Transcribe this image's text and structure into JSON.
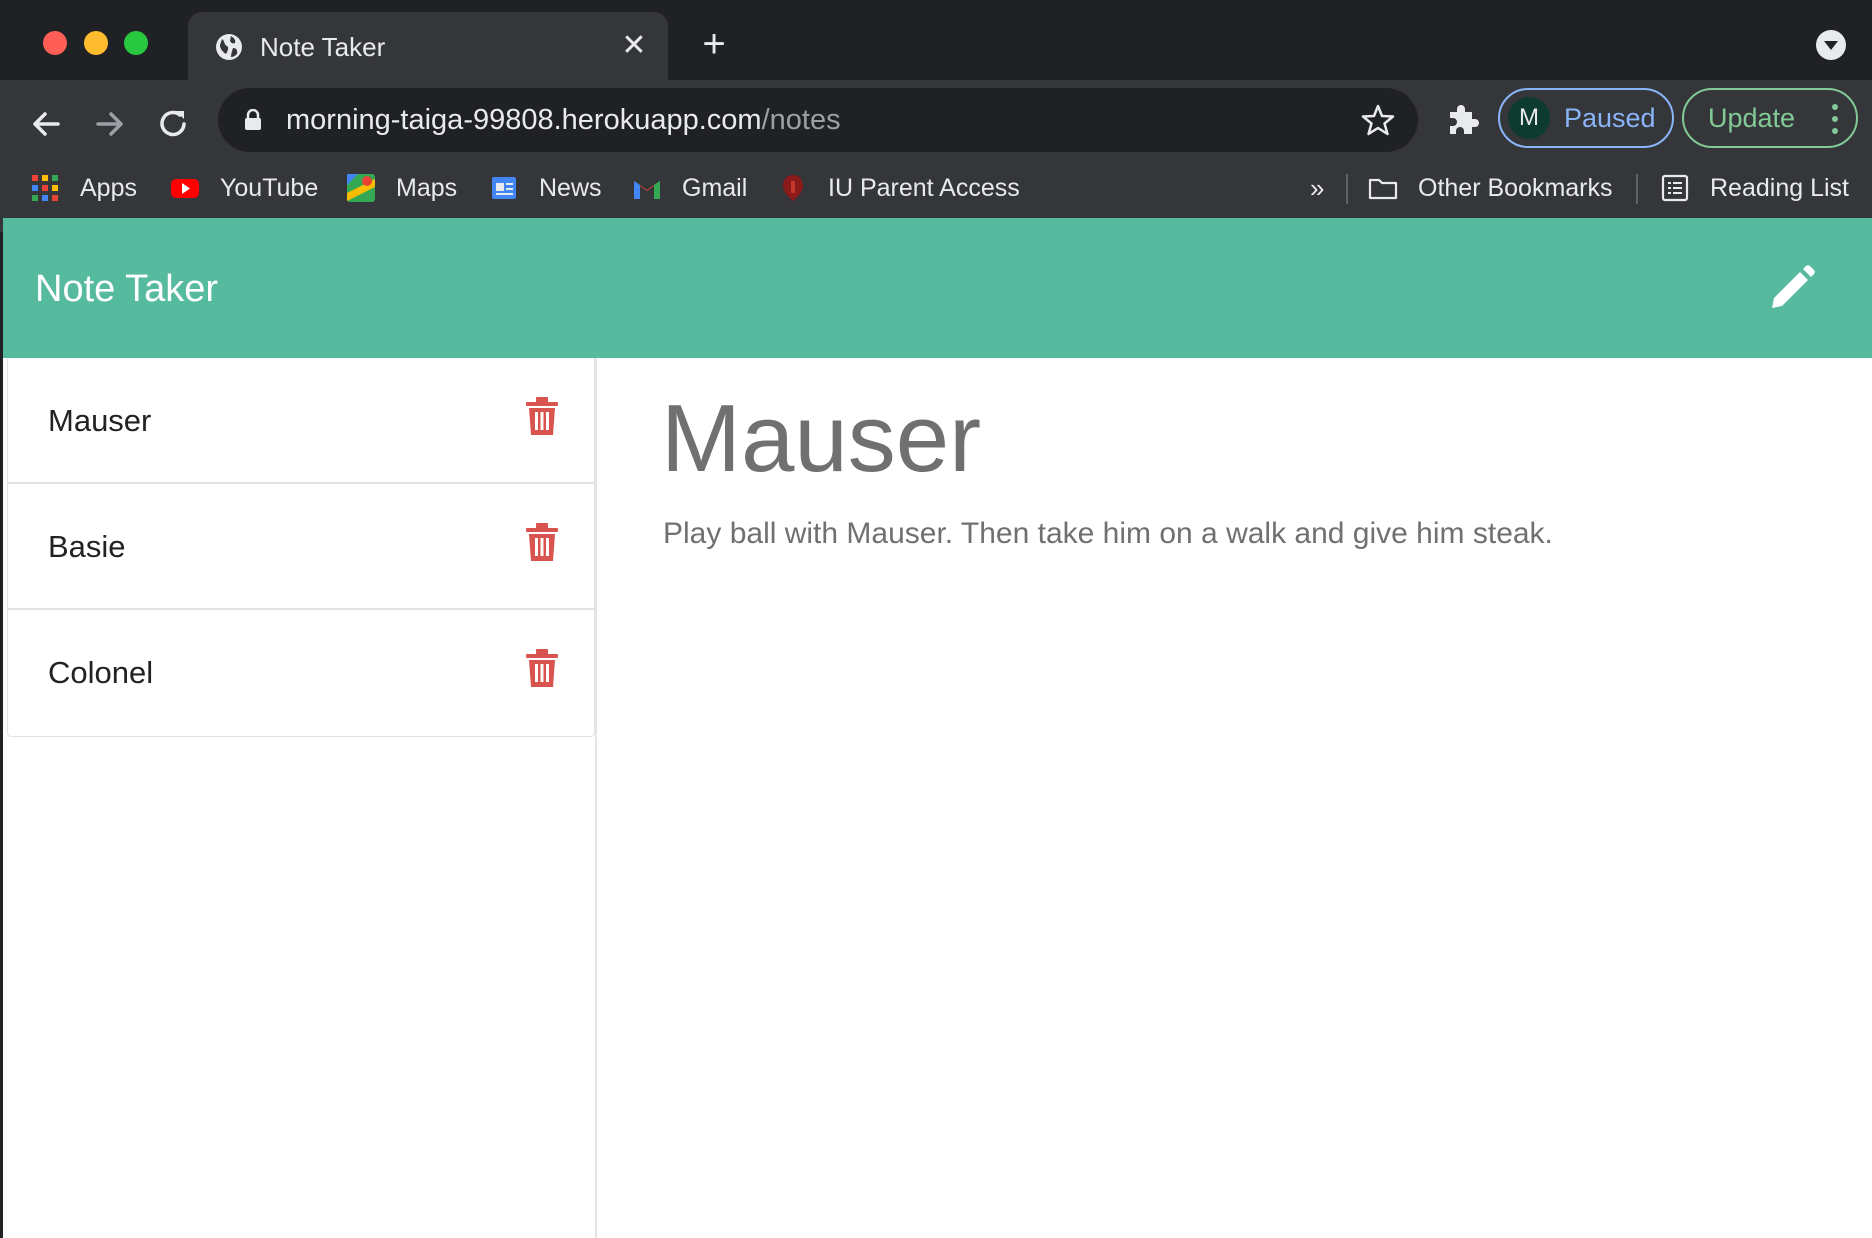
{
  "browser": {
    "tab": {
      "title": "Note Taker"
    },
    "address_bar": {
      "host": "morning-taiga-99808.herokuapp.com",
      "path": "/notes"
    },
    "profile": {
      "initial": "M",
      "label": "Paused"
    },
    "update_label": "Update",
    "bookmarks": [
      {
        "label": "Apps",
        "icon": "apps-grid-icon"
      },
      {
        "label": "YouTube",
        "icon": "youtube-icon"
      },
      {
        "label": "Maps",
        "icon": "maps-icon"
      },
      {
        "label": "News",
        "icon": "news-icon"
      },
      {
        "label": "Gmail",
        "icon": "gmail-icon"
      },
      {
        "label": "IU Parent Access",
        "icon": "iu-icon"
      }
    ],
    "overflow_label": "»",
    "other_bookmarks": "Other Bookmarks",
    "reading_list": "Reading List"
  },
  "app": {
    "brand": "Note Taker",
    "notes": [
      {
        "title": "Mauser"
      },
      {
        "title": "Basie"
      },
      {
        "title": "Colonel"
      }
    ],
    "active_note": {
      "title": "Mauser",
      "text": "Play ball with Mauser. Then take him on a walk and give him steak."
    }
  },
  "colors": {
    "navbar": "#56ba9e",
    "delete": "#d9534f",
    "text_muted": "#707070"
  }
}
